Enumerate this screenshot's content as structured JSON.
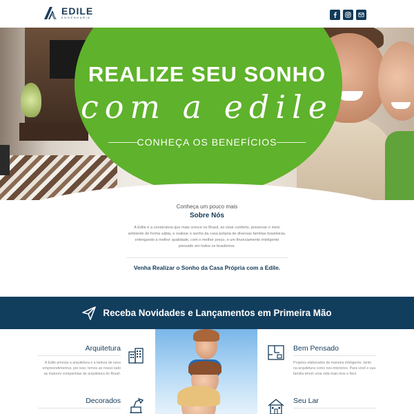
{
  "header": {
    "logo_name": "EDILE",
    "logo_sub": "ENGENHARIA",
    "social": [
      {
        "name": "facebook-icon"
      },
      {
        "name": "instagram-icon"
      },
      {
        "name": "email-icon"
      }
    ]
  },
  "hero": {
    "title": "REALIZE SEU SONHO",
    "script": "com a edile",
    "cta": "CONHEÇA OS BENEFÍCIOS",
    "accent_color": "#5fb22b"
  },
  "about": {
    "kicker": "Conheça um pouco mais",
    "title": "Sobre Nós",
    "text": "A Edile é a construtora que mais cresce no Brasil, ao visar conforto, preservar o meio ambiente de forma sábia, e realizar o sonho da casa própria de diversas famílias brasileiras, entregando a melhor qualidade, com o melhor preço, e um financiamento inteligente pensado em todos os brasileiros.",
    "cta": "Venha Realizar o Sonho da Casa Própria com a Edile."
  },
  "newsletter": {
    "text": "Receba Novidades e Lançamentos em Primeira Mão",
    "bg_color": "#123e5e"
  },
  "features": {
    "arquitetura": {
      "title": "Arquitetura",
      "text": "A Edile prioriza a arquitetura e a beleza de seus empreendimentos, por isso, temos ao nosso lado as maiores companhias de arquitetura do Brasil.",
      "icon": "buildings-icon"
    },
    "decorados": {
      "title": "Decorados",
      "icon": "lamp-desk-icon"
    },
    "bem_pensado": {
      "title": "Bem Pensado",
      "text": "Projetos elaborados de maneira inteligente, tanto na arquitetura como nos interiores. Para você e sua família terem uma vida mais leve e fácil.",
      "icon": "floor-plan-icon"
    },
    "seu_lar": {
      "title": "Seu Lar",
      "icon": "house-icon"
    }
  }
}
